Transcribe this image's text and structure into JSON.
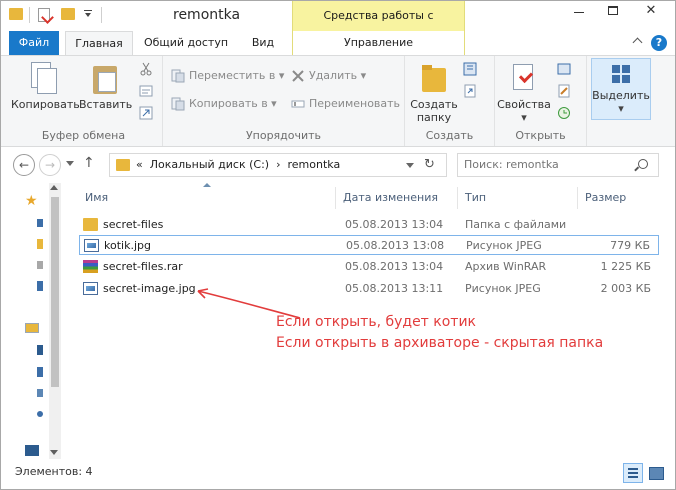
{
  "window": {
    "title": "remontka",
    "context_header": "Средства работы с рисунками"
  },
  "tabs": {
    "file": "Файл",
    "home": "Главная",
    "share": "Общий доступ",
    "view": "Вид",
    "manage": "Управление"
  },
  "ribbon": {
    "clipboard": {
      "copy": "Копировать",
      "paste": "Вставить",
      "label": "Буфер обмена"
    },
    "organize": {
      "move_to": "Переместить в",
      "copy_to": "Копировать в",
      "delete": "Удалить",
      "rename": "Переименовать",
      "label": "Упорядочить"
    },
    "new": {
      "new_folder_line1": "Создать",
      "new_folder_line2": "папку",
      "label": "Создать"
    },
    "open": {
      "properties": "Свойства",
      "label": "Открыть"
    },
    "select": {
      "select": "Выделить"
    }
  },
  "navigation": {
    "address_prefix": "«",
    "address_disk": "Локальный диск (C:)",
    "address_sep": "›",
    "address_folder": "remontka",
    "search_placeholder": "Поиск: remontka"
  },
  "columns": {
    "name": "Имя",
    "date": "Дата изменения",
    "type": "Тип",
    "size": "Размер"
  },
  "files": [
    {
      "name": "secret-files",
      "date": "05.08.2013 13:04",
      "type": "Папка с файлами",
      "size": "",
      "icon": "folder-icon"
    },
    {
      "name": "kotik.jpg",
      "date": "05.08.2013 13:08",
      "type": "Рисунок JPEG",
      "size": "779 КБ",
      "icon": "image-icon"
    },
    {
      "name": "secret-files.rar",
      "date": "05.08.2013 13:04",
      "type": "Архив WinRAR",
      "size": "1 225 КБ",
      "icon": "rar-icon"
    },
    {
      "name": "secret-image.jpg",
      "date": "05.08.2013 13:11",
      "type": "Рисунок JPEG",
      "size": "2 003 КБ",
      "icon": "image-icon"
    }
  ],
  "annotation": {
    "line1": "Если открыть, будет котик",
    "line2": "Если открыть в архиваторе - скрытая папка",
    "color": "#e23c3c"
  },
  "status": {
    "count": "Элементов: 4"
  },
  "colors": {
    "file_tab": "#1979ca",
    "context_tab": "#f8f3a0",
    "selection_border": "#7eb4ea"
  }
}
